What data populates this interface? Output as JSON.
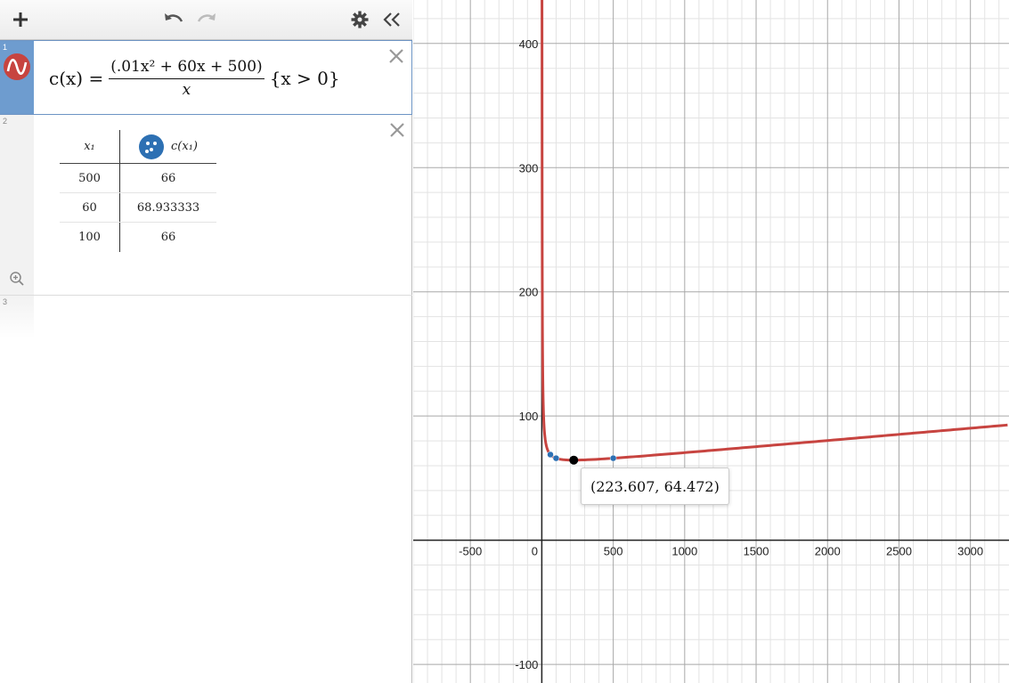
{
  "toolbar": {
    "add_icon": "plus-icon",
    "undo_icon": "undo-icon",
    "redo_icon": "redo-icon",
    "settings_icon": "gear-icon",
    "collapse_icon": "double-chevron-left-icon"
  },
  "expressions": [
    {
      "number": "1",
      "color": "#c74440",
      "lhs": "c(x) =",
      "numerator": "(.01x² + 60x + 500)",
      "denominator": "x",
      "restriction": "{x > 0}"
    },
    {
      "number": "2",
      "color": "#2d70b3",
      "table": {
        "col1_header": "x₁",
        "col2_header": "c(x₁)",
        "rows": [
          {
            "x": "500",
            "y": "66"
          },
          {
            "x": "60",
            "y": "68.933333"
          },
          {
            "x": "100",
            "y": "66"
          }
        ]
      }
    },
    {
      "number": "3"
    }
  ],
  "graph": {
    "x_range": [
      -900,
      3270
    ],
    "y_range": [
      -115,
      435
    ],
    "x_ticks": [
      "-500",
      "0",
      "500",
      "1000",
      "1500",
      "2000",
      "2500",
      "3000"
    ],
    "y_ticks": [
      "400",
      "300",
      "200",
      "100",
      "-100"
    ],
    "curve_color": "#c74440",
    "point_color": "#2d70b3",
    "table_points": [
      [
        500,
        66
      ],
      [
        60,
        68.933333
      ],
      [
        100,
        66
      ]
    ],
    "highlight_point": [
      223.607,
      64.472
    ],
    "tooltip": "(223.607, 64.472)"
  }
}
